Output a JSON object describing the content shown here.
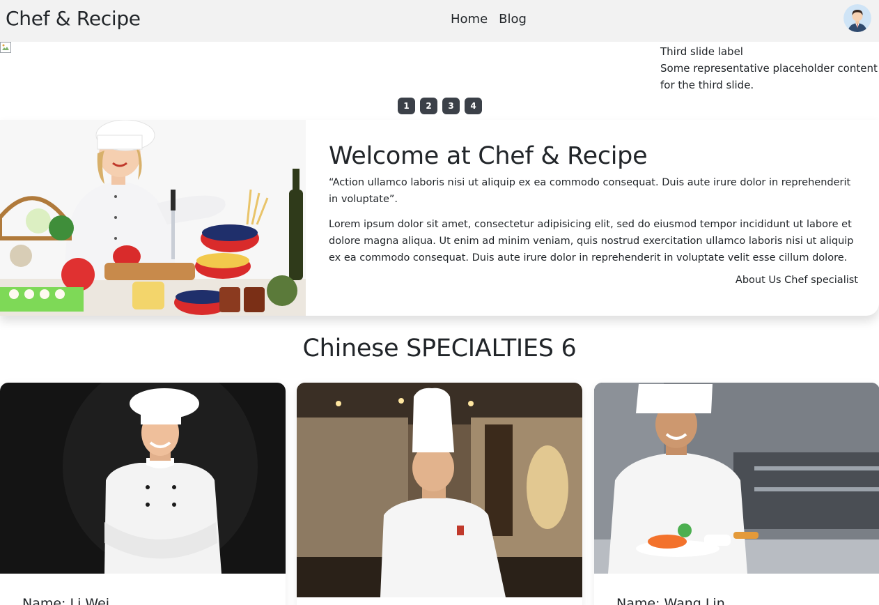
{
  "navbar": {
    "brand": "Chef & Recipe",
    "links": [
      "Home",
      "Blog"
    ]
  },
  "carousel": {
    "caption_title": "Third slide label",
    "caption_text": "Some representative placeholder content for the third slide.",
    "indicators": [
      "1",
      "2",
      "3",
      "4"
    ]
  },
  "welcome": {
    "title": "Welcome at Chef & Recipe",
    "quote": "“Action ullamco laboris nisi ut aliquip ex ea commodo consequat. Duis aute irure dolor in reprehenderit in voluptate”.",
    "body": "Lorem ipsum dolor sit amet, consectetur adipisicing elit, sed do eiusmod tempor incididunt ut labore et dolore magna aliqua. Ut enim ad minim veniam, quis nostrud exercitation ullamco laboris nisi ut aliquip ex ea commodo consequat. Duis aute irure dolor in reprehenderit in voluptate velit esse cillum dolore.",
    "signature": "About Us Chef specialist"
  },
  "section": {
    "title": "Chinese SPECIALTIES 6"
  },
  "chefs": [
    {
      "name": "Name: Li Wei"
    },
    {
      "name": ""
    },
    {
      "name": "Name: Wang Lin"
    }
  ]
}
